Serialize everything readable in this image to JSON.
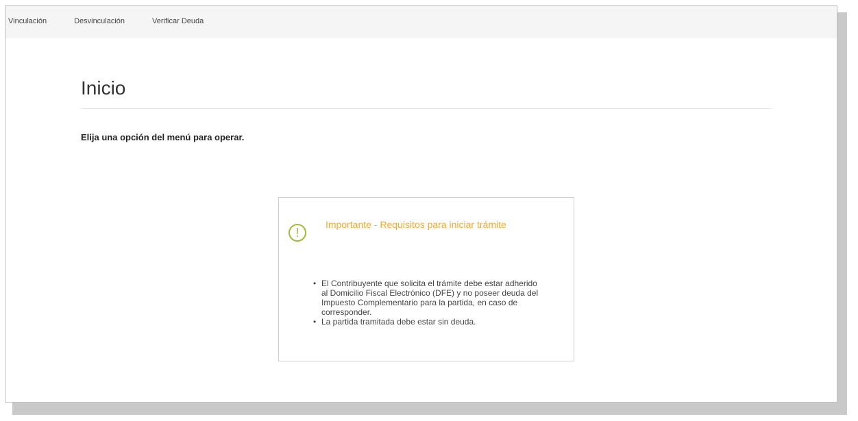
{
  "nav": {
    "items": [
      {
        "label": "Vinculación"
      },
      {
        "label": "Desvinculación"
      },
      {
        "label": "Verificar Deuda"
      }
    ]
  },
  "main": {
    "title": "Inicio",
    "intro": "Elija una opción del menú para operar."
  },
  "notice": {
    "icon_symbol": "!",
    "icon": "exclamation-circle-icon",
    "title": "Importante - Requisitos para iniciar trámite",
    "items": [
      "El Contribuyente que solicita el trámite debe estar adherido al Domicilio Fiscal Electrónico (DFE) y no poseer deuda del Impuesto Complementario para la partida, en caso de corresponder.",
      "La partida tramitada debe estar sin deuda."
    ]
  },
  "colors": {
    "title": "#f0a830",
    "icon": "#a6b73d",
    "navbar_bg": "#f5f5f5"
  }
}
